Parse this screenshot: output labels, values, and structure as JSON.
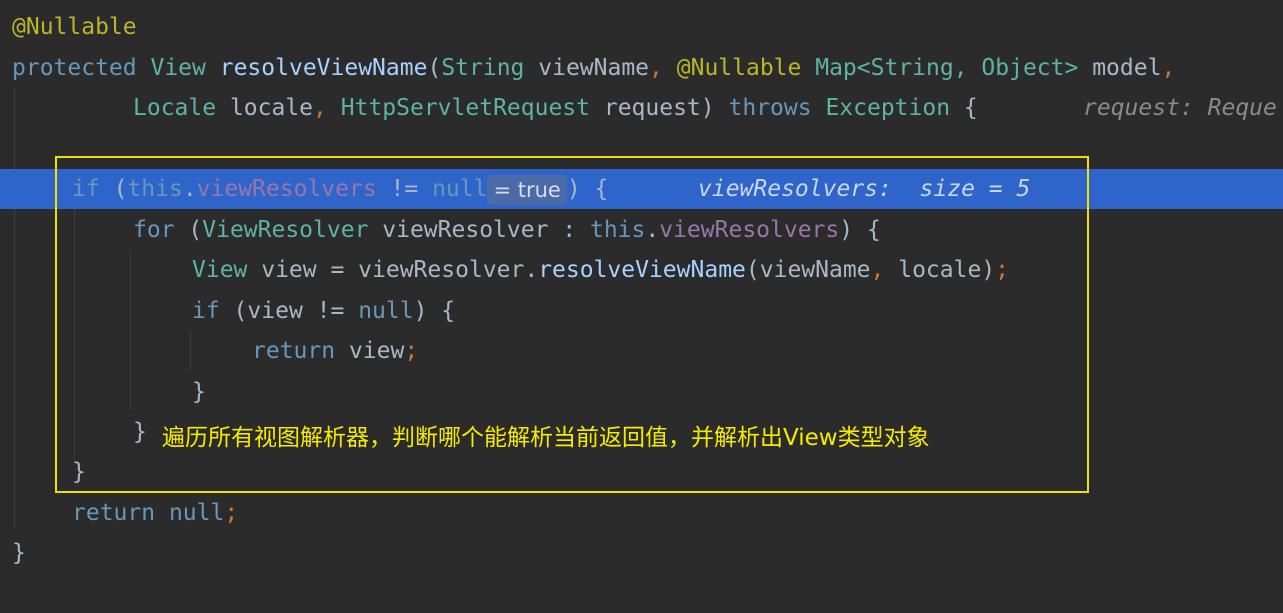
{
  "editor": {
    "lines": {
      "l1": {
        "annotation": "@Nullable"
      },
      "l2": {
        "kw_protected": "protected",
        "type_view": "View",
        "method": "resolveViewName",
        "paren": "(",
        "type_string": "String",
        "param_viewname": " viewName",
        "comma": ",",
        "annotation": "@Nullable",
        "type_map": "Map<String,",
        "type_object": "Object>",
        "param_model": " model",
        "comma2": ","
      },
      "l3": {
        "type_locale": "Locale",
        "param_locale": " locale",
        "comma": ",",
        "type_request": "HttpServletRequest",
        "param_request": " request)",
        "kw_throws": "throws",
        "type_exception": "Exception",
        "brace": "{",
        "hint": "request: Reque"
      },
      "l4": {
        "kw_if": "if",
        "paren_open": "(",
        "this": "this",
        "dot": ".",
        "field": "viewResolvers",
        "op": " != ",
        "null_kw": "null",
        "inline_value": "= true",
        "paren_close": ") {",
        "hint": "viewResolvers:  size = 5"
      },
      "l5": {
        "kw_for": "for",
        "paren_open": " (",
        "type": "ViewResolver",
        "var": " viewResolver : ",
        "this": "this",
        "dot": ".",
        "field": "viewResolvers",
        "paren_close": ") {"
      },
      "l6": {
        "type": "View",
        "var": " view = viewResolver.",
        "method": "resolveViewName",
        "args": "(viewName",
        "comma": ",",
        "arg2": " locale)",
        "semi": ";"
      },
      "l7": {
        "kw_if": "if",
        "cond": " (view != ",
        "null_kw": "null",
        "close": ") {"
      },
      "l8": {
        "kw_return": "return",
        "val": " view",
        "semi": ";"
      },
      "l9": {
        "brace": "}"
      },
      "l10": {
        "brace": "}",
        "note": "遍历所有视图解析器，判断哪个能解析当前返回值，并解析出View类型对象"
      },
      "l11": {
        "brace": "}"
      },
      "l12": {
        "kw_return": "return",
        "null_kw": " null",
        "semi": ";"
      },
      "l13": {
        "brace": "}"
      }
    }
  },
  "colors": {
    "background": "#2b2b2b",
    "highlight_line": "#2f65ca",
    "annotation_box": "#f0e000",
    "keyword": "#cc7832",
    "type": "#5fb3a1",
    "field": "#9876aa"
  }
}
